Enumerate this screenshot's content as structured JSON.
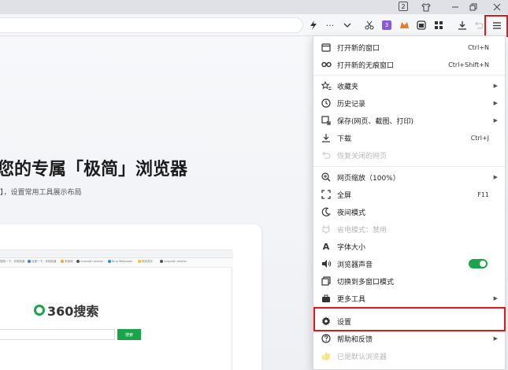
{
  "titlebar": {
    "tab_count": "2"
  },
  "toolbar": {
    "icons": [
      "lightning-icon",
      "more-icon",
      "chevron-down-icon",
      "scissors-icon",
      "extension-purple-icon",
      "extension-orange-icon",
      "screenshot-icon",
      "apps-icon",
      "download-icon",
      "undo-icon",
      "menu-icon"
    ]
  },
  "page": {
    "headline": "您的专属「极简」浏览器",
    "subline": "】，设置常用工具展示布局",
    "preview": {
      "bookmarks": [
        "搜索一下，你就知道",
        "百度一下，你就知道",
        "淘宝网",
        "unsplash photos",
        "Bing Wallpaper",
        "网页变灰",
        "unsplash photos"
      ],
      "logo_text": "360搜索",
      "search_button": "搜索"
    }
  },
  "menu": {
    "items": [
      {
        "label": "打开新的窗口",
        "shortcut": "Ctrl+N",
        "icon": "new-window-icon"
      },
      {
        "label": "打开新的无痕窗口",
        "shortcut": "Ctrl+Shift+N",
        "icon": "incognito-icon"
      },
      {
        "label": "收藏夹",
        "icon": "star-list-icon",
        "submenu": true
      },
      {
        "label": "历史记录",
        "icon": "history-icon",
        "submenu": true
      },
      {
        "label": "保存(网页、截图、打印)",
        "icon": "save-icon",
        "submenu": true
      },
      {
        "label": "下载",
        "shortcut": "Ctrl+J",
        "icon": "download-icon"
      },
      {
        "label": "恢复关闭的网页",
        "icon": "restore-icon",
        "disabled": true
      },
      {
        "label": "网页缩放（100%）",
        "icon": "zoom-icon",
        "submenu": true
      },
      {
        "label": "全屏",
        "shortcut": "F11",
        "icon": "fullscreen-icon"
      },
      {
        "label": "夜间模式",
        "icon": "moon-icon"
      },
      {
        "label": "省电模式：禁用",
        "icon": "power-save-icon",
        "disabled": true
      },
      {
        "label": "字体大小",
        "icon": "font-size-icon"
      },
      {
        "label": "浏览器声音",
        "icon": "sound-icon",
        "toggle_on": true
      },
      {
        "label": "切换到多窗口模式",
        "icon": "multi-window-icon"
      },
      {
        "label": "更多工具",
        "icon": "toolbox-icon",
        "submenu": true
      },
      {
        "label": "设置",
        "icon": "gear-icon"
      },
      {
        "label": "帮助和反馈",
        "icon": "help-icon",
        "submenu": true
      },
      {
        "label": "已是默认浏览器",
        "icon": "thumb-up-icon",
        "disabled": true
      }
    ]
  },
  "colors": {
    "accent_green": "#1aa54a",
    "highlight_red": "#e01818"
  }
}
